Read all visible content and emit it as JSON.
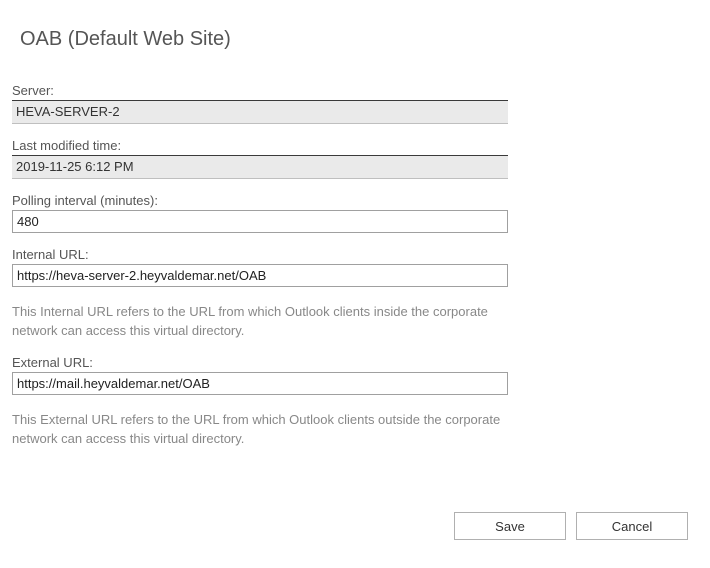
{
  "title": "OAB (Default Web Site)",
  "fields": {
    "server": {
      "label": "Server:",
      "value": "HEVA-SERVER-2"
    },
    "last_modified": {
      "label": "Last modified time:",
      "value": "2019-11-25 6:12 PM"
    },
    "polling_interval": {
      "label": "Polling interval (minutes):",
      "value": "480"
    },
    "internal_url": {
      "label": "Internal URL:",
      "value": "https://heva-server-2.heyvaldemar.net/OAB",
      "help": "This Internal URL refers to the URL from which Outlook clients inside the corporate network can access this virtual directory."
    },
    "external_url": {
      "label": "External URL:",
      "value": "https://mail.heyvaldemar.net/OAB",
      "help": "This External URL refers to the URL from which Outlook clients outside the corporate network can access this virtual directory."
    }
  },
  "buttons": {
    "save": "Save",
    "cancel": "Cancel"
  }
}
